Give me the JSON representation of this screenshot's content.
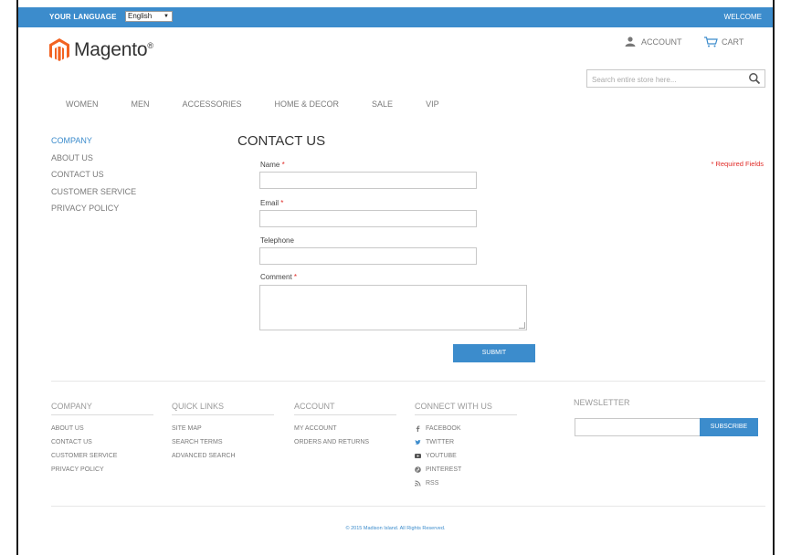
{
  "header": {
    "language_label": "YOUR LANGUAGE",
    "language_value": "English",
    "welcome": "WELCOME",
    "logo_text": "Magento",
    "logo_mark": "®",
    "account": "ACCOUNT",
    "cart": "CART",
    "search_placeholder": "Search entire store here..."
  },
  "nav": [
    "WOMEN",
    "MEN",
    "ACCESSORIES",
    "HOME & DECOR",
    "SALE",
    "VIP"
  ],
  "sidebar": [
    "COMPANY",
    "ABOUT US",
    "CONTACT US",
    "CUSTOMER SERVICE",
    "PRIVACY POLICY"
  ],
  "form": {
    "title": "CONTACT US",
    "required_note": "* Required Fields",
    "name_label": "Name",
    "email_label": "Email",
    "telephone_label": "Telephone",
    "comment_label": "Comment",
    "star": "*",
    "submit": "SUBMIT"
  },
  "footer": {
    "company": {
      "title": "COMPANY",
      "items": [
        "ABOUT US",
        "CONTACT US",
        "CUSTOMER SERVICE",
        "PRIVACY POLICY"
      ]
    },
    "quick_links": {
      "title": "QUICK LINKS",
      "items": [
        "SITE MAP",
        "SEARCH TERMS",
        "ADVANCED SEARCH"
      ]
    },
    "account": {
      "title": "ACCOUNT",
      "items": [
        "MY ACCOUNT",
        "ORDERS AND RETURNS"
      ]
    },
    "connect": {
      "title": "CONNECT WITH US",
      "items": [
        "FACEBOOK",
        "TWITTER",
        "YOUTUBE",
        "PINTEREST",
        "RSS"
      ]
    },
    "newsletter": {
      "title": "NEWSLETTER",
      "button": "SUBSCRIBE"
    },
    "copyright": "© 2015 Madison Island. All Rights Reserved."
  },
  "colors": {
    "accent": "#3c8ccc",
    "logo_orange": "#f26322",
    "required": "#e02b27"
  }
}
